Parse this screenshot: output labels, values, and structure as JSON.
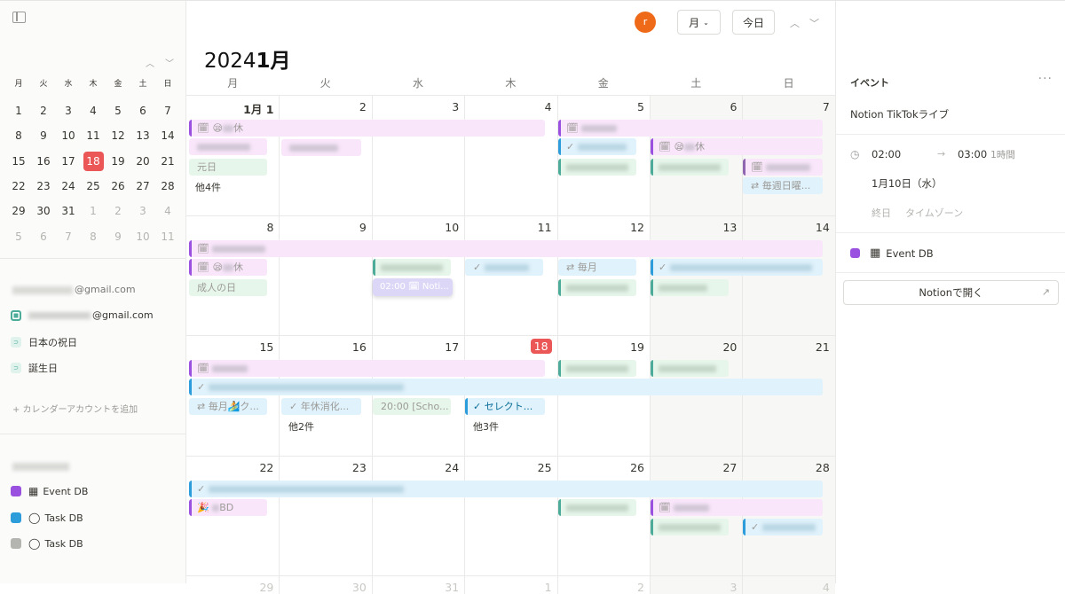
{
  "sidebar": {
    "mini_calendar": {
      "weekdays": [
        "月",
        "火",
        "水",
        "木",
        "金",
        "土",
        "日"
      ],
      "weeks": [
        [
          "1",
          "2",
          "3",
          "4",
          "5",
          "6",
          "7"
        ],
        [
          "8",
          "9",
          "10",
          "11",
          "12",
          "13",
          "14"
        ],
        [
          "15",
          "16",
          "17",
          "18",
          "19",
          "20",
          "21"
        ],
        [
          "22",
          "23",
          "24",
          "25",
          "26",
          "27",
          "28"
        ],
        [
          "29",
          "30",
          "31",
          "1",
          "2",
          "3",
          "4"
        ],
        [
          "5",
          "6",
          "7",
          "8",
          "9",
          "10",
          "11"
        ]
      ],
      "today": "18",
      "prev_icon": "chevron-up-icon",
      "next_icon": "chevron-down-icon"
    },
    "account1_email_suffix": "@gmail.com",
    "account1_calendars": [
      {
        "label": "@gmail.com",
        "color": "#4dab9a"
      },
      {
        "label": "日本の祝日",
        "color": "#4dab9a"
      },
      {
        "label": "誕生日",
        "color": "#4dab9a"
      }
    ],
    "add_account": "+ カレンダーアカウントを追加",
    "account2_calendars": [
      {
        "label": "Event DB",
        "color": "#9b51e0"
      },
      {
        "label": "Task DB",
        "color": "#2d9cdb"
      },
      {
        "label": "Task DB",
        "color": "#9b9a97"
      }
    ]
  },
  "header": {
    "avatar_letter": "r",
    "view_label": "月",
    "today_label": "今日",
    "year": "2024",
    "month": "1月"
  },
  "calendar": {
    "weekdays": [
      "月",
      "火",
      "水",
      "木",
      "金",
      "土",
      "日"
    ],
    "weeks": [
      [
        "1月 1",
        "2",
        "3",
        "4",
        "5",
        "6",
        "7"
      ],
      [
        "8",
        "9",
        "10",
        "11",
        "12",
        "13",
        "14"
      ],
      [
        "15",
        "16",
        "17",
        "18",
        "19",
        "20",
        "21"
      ],
      [
        "22",
        "23",
        "24",
        "25",
        "26",
        "27",
        "28"
      ]
    ],
    "next_row_partial": [
      "29",
      "30",
      "31",
      "1",
      "2",
      "3",
      "4"
    ],
    "today": "18",
    "events": {
      "w1_kyu": "休",
      "w1_ganjitsu": "元日",
      "w1_more": "他4件",
      "w1_sat_kyu": "休",
      "w1_sun_weekly": "毎週日曜...",
      "w2_kyu": "休",
      "w2_seijin": "成人の日",
      "w2_drag": "02:00 🗓 Noti...",
      "w2_monthly": "毎月",
      "w3_monthly": "毎月🏄ク...",
      "w3_leave": "年休消化...",
      "w3_more_tue": "他2件",
      "w3_school": "20:00 [Scho...",
      "w3_select": "セレクト...",
      "w3_more_thu": "他3件",
      "w4_bd": "BD"
    }
  },
  "panel": {
    "heading": "イベント",
    "more_icon": "more-horizontal-icon",
    "event_title": "Notion TikTokライブ",
    "start_time": "02:00",
    "end_time": "03:00",
    "duration": "1時間",
    "date": "1月10日（水）",
    "option_allday": "終日",
    "option_timezone": "タイムゾーン",
    "db_name": "Event DB",
    "db_color": "#9b51e0",
    "open_label": "Notionで開く"
  }
}
